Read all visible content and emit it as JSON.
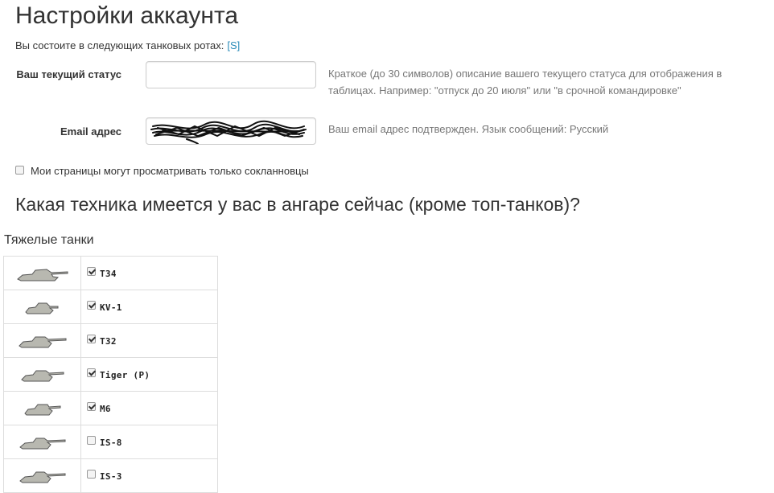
{
  "page": {
    "title": "Настройки аккаунта",
    "companies_text": "Вы состоите в следующих танковых ротах:",
    "companies_link": "[S]"
  },
  "status_field": {
    "label": "Ваш текущий статус",
    "value": "",
    "help": "Краткое (до 30 символов) описание вашего текущего статуса для отображения в таблицах. Например: \"отпуск до 20 июля\" или \"в срочной командировке\""
  },
  "email_field": {
    "label": "Email адрес",
    "help": "Ваш email адрес подтвержден. Язык сообщений: Русский"
  },
  "privacy": {
    "label": "Мои страницы могут просматривать только сокланновцы",
    "checked": false
  },
  "hangar": {
    "title": "Какая техника имеется у вас в ангаре сейчас (кроме топ-танков)?",
    "category": "Тяжелые танки",
    "tanks": [
      {
        "name": "T34",
        "checked": true,
        "icon": "tank-icon"
      },
      {
        "name": "KV-1",
        "checked": true,
        "icon": "tank-icon"
      },
      {
        "name": "T32",
        "checked": true,
        "icon": "tank-icon"
      },
      {
        "name": "Tiger (P)",
        "checked": true,
        "icon": "tank-icon"
      },
      {
        "name": "M6",
        "checked": true,
        "icon": "tank-icon"
      },
      {
        "name": "IS-8",
        "checked": false,
        "icon": "tank-icon"
      },
      {
        "name": "IS-3",
        "checked": false,
        "icon": "tank-icon"
      }
    ]
  },
  "colors": {
    "link": "#2a8bb8",
    "help_text": "#777777",
    "border": "#dddddd"
  }
}
